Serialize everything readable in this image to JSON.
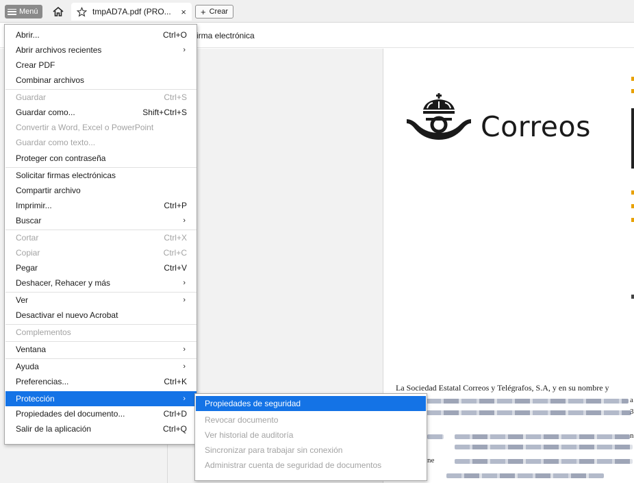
{
  "tabbar": {
    "menu_label": "Menú",
    "tab_title": "tmpAD7A.pdf (PRO...",
    "tab_close": "×",
    "new_tab_plus": "+",
    "new_tab_label": "Crear"
  },
  "toolbar": {
    "label": "irma electrónica"
  },
  "document": {
    "logo_text": "Correos",
    "body_line": "La Sociedad Estatal Correos y Telégrafos, S.A, y  en su  nombre y",
    "snippet_1": "a",
    "snippet_2": "3",
    "snippet_3": "n",
    "snippet_4": "ne"
  },
  "menu": {
    "items": [
      {
        "label": "Abrir...",
        "shortcut": "Ctrl+O",
        "disabled": false
      },
      {
        "label": "Abrir archivos recientes",
        "shortcut": "›",
        "disabled": false
      },
      {
        "label": "Crear PDF",
        "shortcut": "",
        "disabled": false
      },
      {
        "label": "Combinar archivos",
        "shortcut": "",
        "disabled": false
      },
      {
        "label": "Guardar",
        "shortcut": "Ctrl+S",
        "disabled": true
      },
      {
        "label": "Guardar como...",
        "shortcut": "Shift+Ctrl+S",
        "disabled": false
      },
      {
        "label": "Convertir a Word, Excel o PowerPoint",
        "shortcut": "",
        "disabled": true
      },
      {
        "label": "Guardar como texto...",
        "shortcut": "",
        "disabled": true
      },
      {
        "label": "Proteger con contraseña",
        "shortcut": "",
        "disabled": false
      },
      {
        "label": "Solicitar firmas electrónicas",
        "shortcut": "",
        "disabled": false
      },
      {
        "label": "Compartir archivo",
        "shortcut": "",
        "disabled": false
      },
      {
        "label": "Imprimir...",
        "shortcut": "Ctrl+P",
        "disabled": false
      },
      {
        "label": "Buscar",
        "shortcut": "›",
        "disabled": false
      },
      {
        "label": "Cortar",
        "shortcut": "Ctrl+X",
        "disabled": true
      },
      {
        "label": "Copiar",
        "shortcut": "Ctrl+C",
        "disabled": true
      },
      {
        "label": "Pegar",
        "shortcut": "Ctrl+V",
        "disabled": false
      },
      {
        "label": "Deshacer, Rehacer y más",
        "shortcut": "›",
        "disabled": false
      },
      {
        "label": "Ver",
        "shortcut": "›",
        "disabled": false
      },
      {
        "label": "Desactivar el nuevo Acrobat",
        "shortcut": "",
        "disabled": false
      },
      {
        "label": "Complementos",
        "shortcut": "",
        "disabled": true
      },
      {
        "label": "Ventana",
        "shortcut": "›",
        "disabled": false
      },
      {
        "label": "Ayuda",
        "shortcut": "›",
        "disabled": false
      },
      {
        "label": "Preferencias...",
        "shortcut": "Ctrl+K",
        "disabled": false
      },
      {
        "label": "Protección",
        "shortcut": "›",
        "disabled": false,
        "active": true
      },
      {
        "label": "Propiedades del documento...",
        "shortcut": "Ctrl+D",
        "disabled": false
      },
      {
        "label": "Salir de la aplicación",
        "shortcut": "Ctrl+Q",
        "disabled": false
      }
    ]
  },
  "submenu": {
    "items": [
      {
        "label": "Propiedades de seguridad",
        "active": true
      },
      {
        "label": "Revocar documento",
        "disabled": true
      },
      {
        "label": "Ver historial de auditoría",
        "disabled": true
      },
      {
        "label": "Sincronizar para trabajar sin conexión",
        "disabled": true
      },
      {
        "label": "Administrar cuenta de seguridad de documentos",
        "disabled": true
      }
    ]
  },
  "colors": {
    "accent": "#1473e6",
    "disabled_text": "#a3a3a3",
    "logo_accent": "#e8a100"
  }
}
